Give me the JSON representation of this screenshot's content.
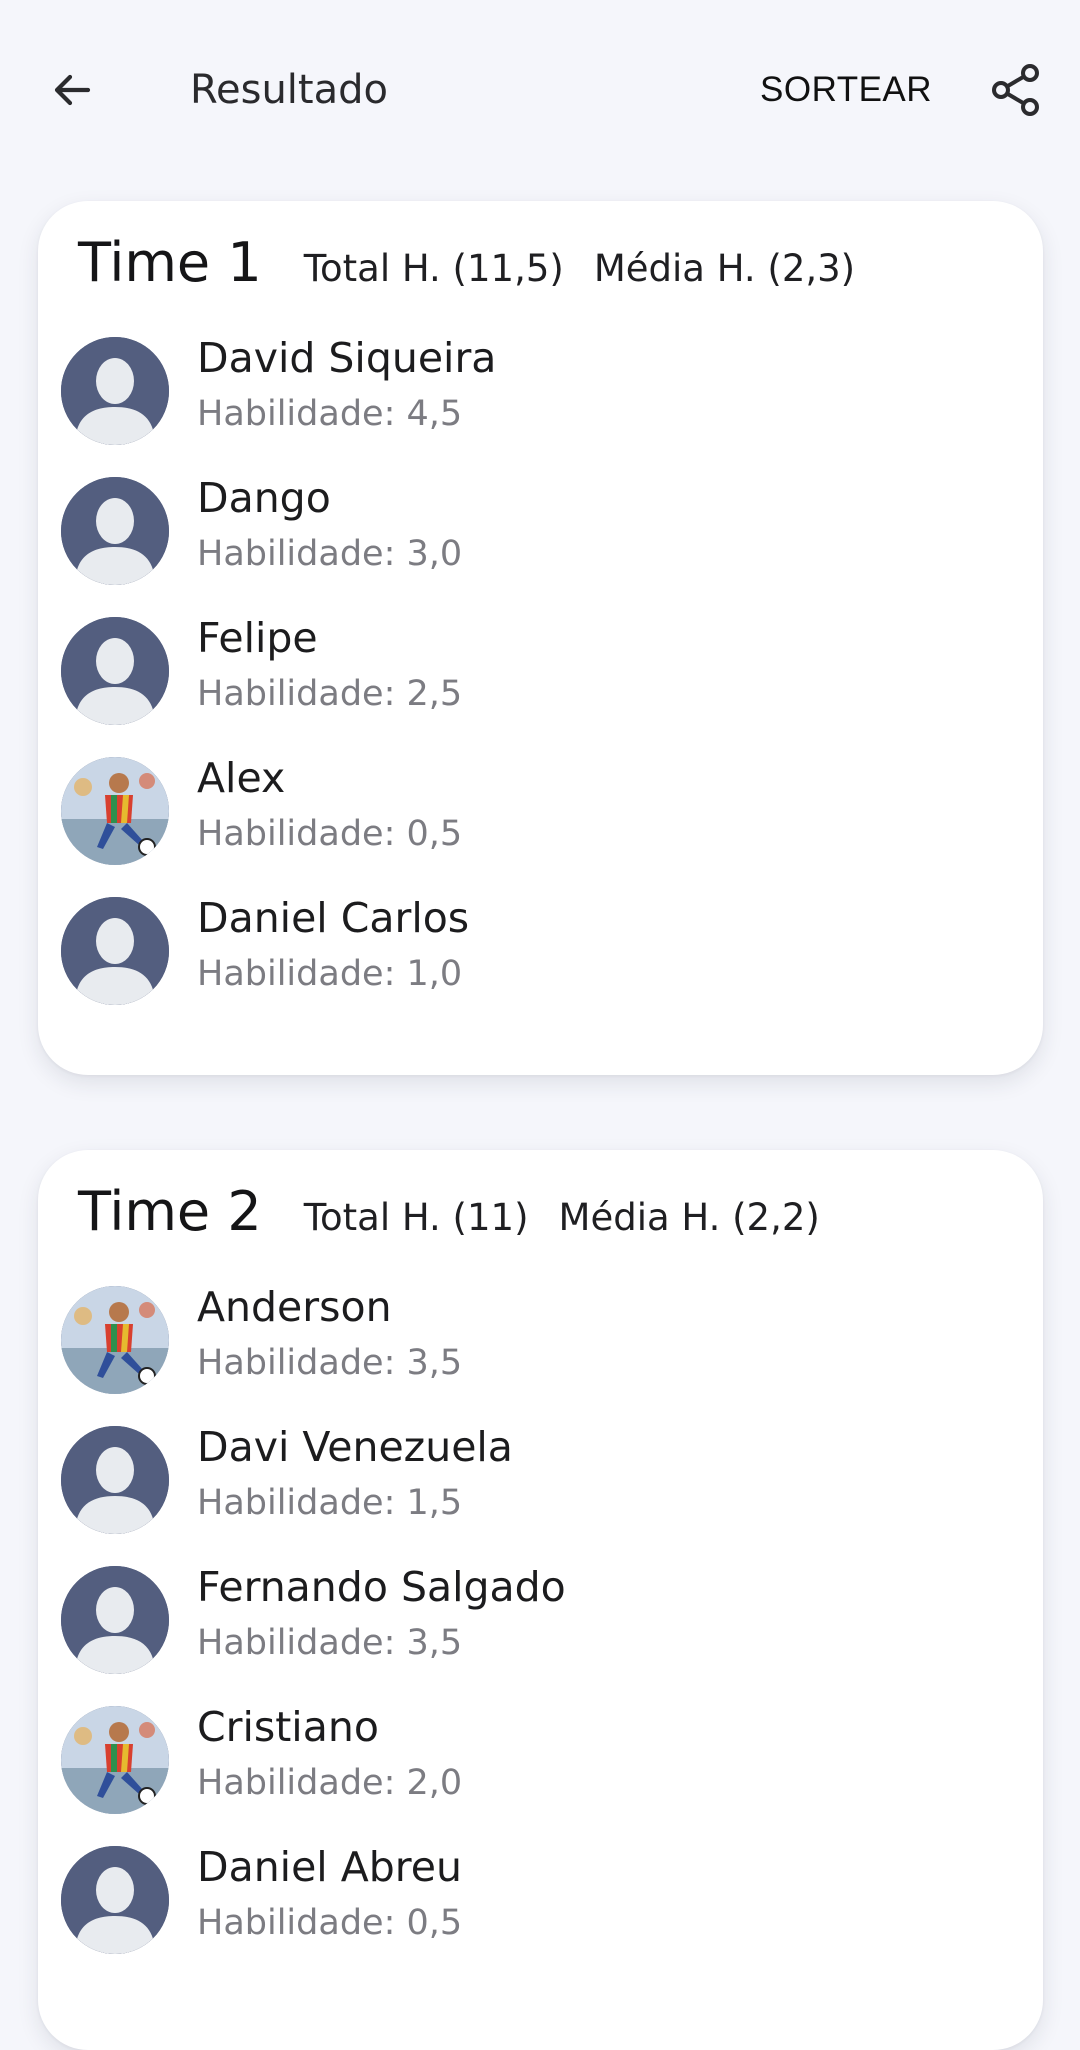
{
  "header": {
    "title": "Resultado",
    "sortear_label": "SORTEAR",
    "back_icon": "arrow-back-icon",
    "share_icon": "share-icon"
  },
  "colors": {
    "background": "#f5f6fb",
    "card": "#ffffff",
    "avatar_placeholder": "#535e7f",
    "secondary_text": "#7c7c82"
  },
  "teams": [
    {
      "name": "Time 1",
      "total": "Total H. (11,5)",
      "media": "Média H. (2,3)",
      "players": [
        {
          "name": "David Siqueira",
          "skill": "Habilidade: 4,5",
          "avatar": "default"
        },
        {
          "name": "Dango",
          "skill": "Habilidade: 3,0",
          "avatar": "default"
        },
        {
          "name": "Felipe",
          "skill": "Habilidade: 2,5",
          "avatar": "default"
        },
        {
          "name": "Alex",
          "skill": "Habilidade: 0,5",
          "avatar": "photo"
        },
        {
          "name": "Daniel Carlos",
          "skill": "Habilidade: 1,0",
          "avatar": "default"
        }
      ]
    },
    {
      "name": "Time 2",
      "total": "Total H. (11)",
      "media": "Média H. (2,2)",
      "players": [
        {
          "name": "Anderson",
          "skill": "Habilidade: 3,5",
          "avatar": "photo"
        },
        {
          "name": "Davi Venezuela",
          "skill": "Habilidade: 1,5",
          "avatar": "default"
        },
        {
          "name": "Fernando Salgado",
          "skill": "Habilidade: 3,5",
          "avatar": "default"
        },
        {
          "name": "Cristiano",
          "skill": "Habilidade: 2,0",
          "avatar": "photo"
        },
        {
          "name": "Daniel Abreu",
          "skill": "Habilidade: 0,5",
          "avatar": "default"
        }
      ]
    }
  ]
}
